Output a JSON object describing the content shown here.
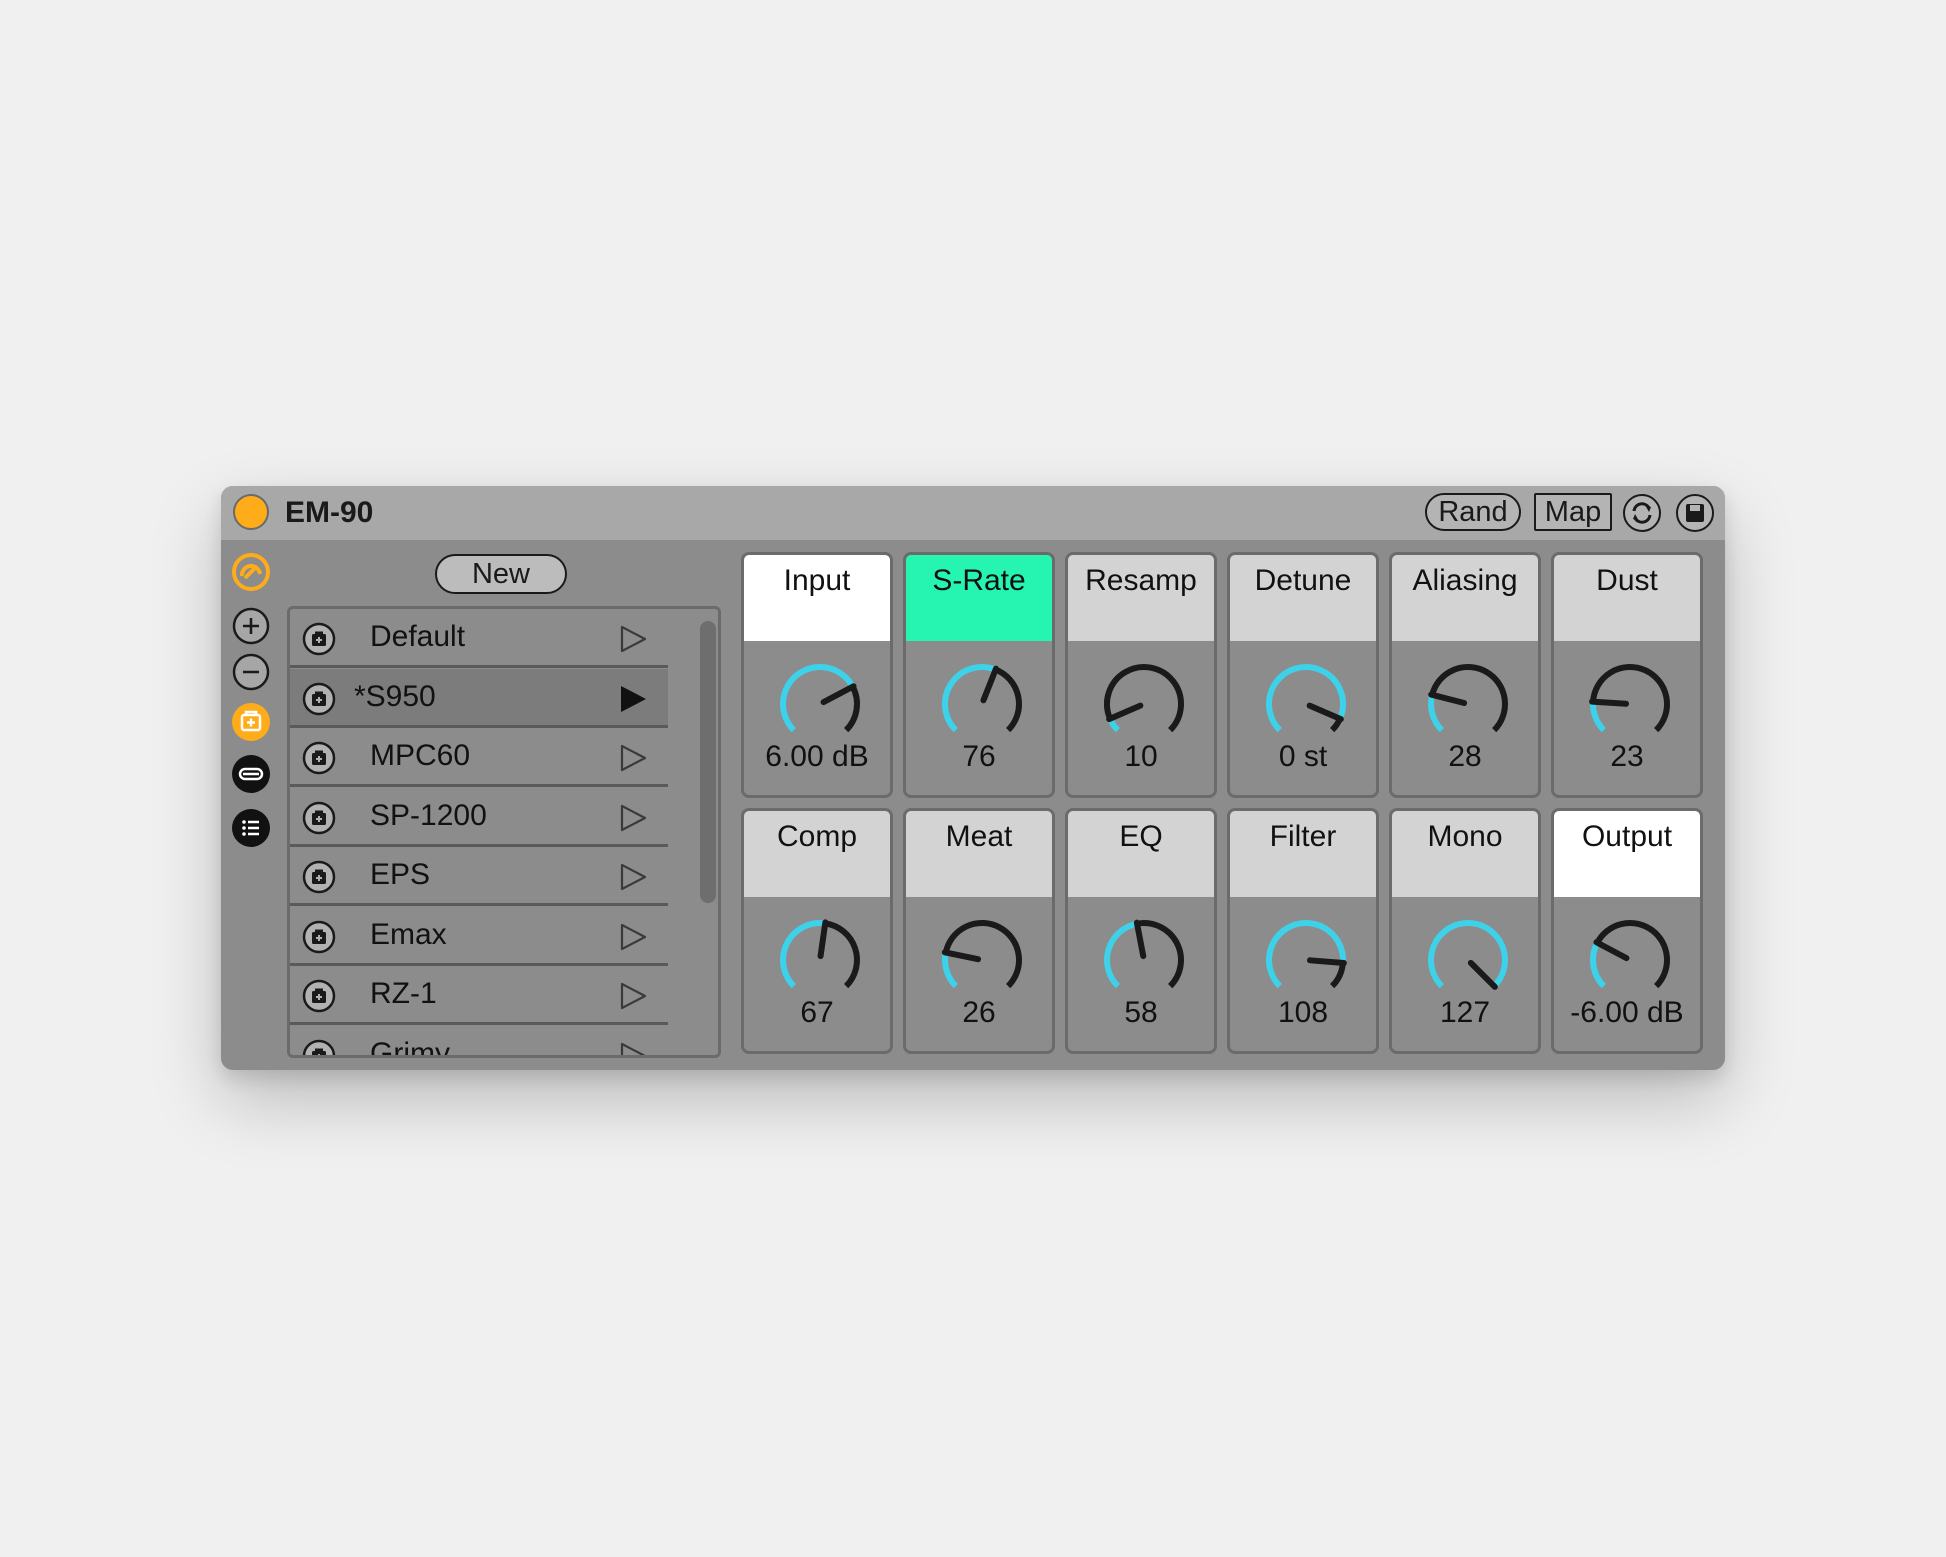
{
  "titlebar": {
    "title": "EM-90",
    "rand_label": "Rand",
    "map_label": "Map",
    "power_color": "#ffac1a"
  },
  "sidebar_icons": [
    "macro-logo-icon",
    "plus-icon",
    "minus-icon",
    "preset-add-icon",
    "minus-filled-icon",
    "list-icon"
  ],
  "presets": {
    "new_label": "New",
    "items": [
      {
        "name": "Default",
        "selected": false,
        "playing": false
      },
      {
        "name": "*S950",
        "selected": true,
        "playing": true
      },
      {
        "name": "MPC60",
        "selected": false,
        "playing": false
      },
      {
        "name": "SP-1200",
        "selected": false,
        "playing": false
      },
      {
        "name": "EPS",
        "selected": false,
        "playing": false
      },
      {
        "name": "Emax",
        "selected": false,
        "playing": false
      },
      {
        "name": "RZ-1",
        "selected": false,
        "playing": false
      },
      {
        "name": "Grimy",
        "selected": false,
        "playing": false
      }
    ]
  },
  "colors": {
    "accent": "#3ed2ea",
    "highlight": "#25f5b0",
    "header": "#d3d3d3",
    "header_active": "#ffffff"
  },
  "knobs": [
    {
      "label": "Input",
      "value": "6.00 dB",
      "fraction": 0.73,
      "header": "white"
    },
    {
      "label": "S-Rate",
      "value": "76",
      "fraction": 0.58,
      "header": "green"
    },
    {
      "label": "Resamp",
      "value": "10",
      "fraction": 0.08,
      "header": "grey"
    },
    {
      "label": "Detune",
      "value": "0 st",
      "fraction": 0.92,
      "header": "grey"
    },
    {
      "label": "Aliasing",
      "value": "28",
      "fraction": 0.22,
      "header": "grey"
    },
    {
      "label": "Dust",
      "value": "23",
      "fraction": 0.18,
      "header": "grey"
    },
    {
      "label": "Comp",
      "value": "67",
      "fraction": 0.53,
      "header": "grey"
    },
    {
      "label": "Meat",
      "value": "26",
      "fraction": 0.21,
      "header": "grey"
    },
    {
      "label": "EQ",
      "value": "58",
      "fraction": 0.46,
      "header": "grey"
    },
    {
      "label": "Filter",
      "value": "108",
      "fraction": 0.85,
      "header": "grey"
    },
    {
      "label": "Mono",
      "value": "127",
      "fraction": 1.0,
      "header": "grey"
    },
    {
      "label": "Output",
      "value": "-6.00 dB",
      "fraction": 0.27,
      "header": "white"
    }
  ]
}
